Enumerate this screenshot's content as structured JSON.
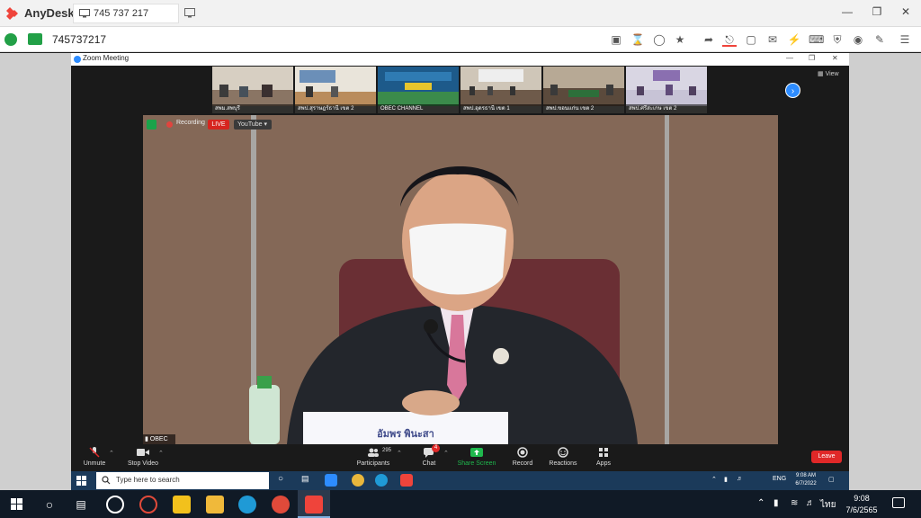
{
  "anydesk": {
    "brand": "AnyDesk",
    "tab_label": "745 737 217",
    "address": "745737217"
  },
  "zoom": {
    "window_title": "Zoom Meeting",
    "view_label": "View",
    "thumbnails": [
      {
        "label": "สพม.สพบุรี"
      },
      {
        "label": "สพป.สุราษฎร์ธานี เขต 2"
      },
      {
        "label": "OBEC CHANNEL"
      },
      {
        "label": "สพป.อุดรธานี เขต 1"
      },
      {
        "label": "สพป.ขอนแก่น เขต 2"
      },
      {
        "label": "สพป.ศรีสะเกษ เขต 2"
      }
    ],
    "recording": {
      "label": "Recording",
      "live": "LIVE",
      "platform": "YouTube"
    },
    "speaker_name": "OBEC",
    "nameplate": "อัมพร พินะสา",
    "controls": {
      "unmute": "Unmute",
      "stop_video": "Stop Video",
      "participants": "Participants",
      "participants_count": "295",
      "chat": "Chat",
      "chat_badge": "4",
      "share_screen": "Share Screen",
      "record": "Record",
      "reactions": "Reactions",
      "apps": "Apps",
      "leave": "Leave"
    }
  },
  "remote_taskbar": {
    "search_placeholder": "Type here to search",
    "language": "ENG",
    "time": "9:08 AM",
    "date": "6/7/2022"
  },
  "host_taskbar": {
    "language": "ไทย",
    "time": "9:08",
    "date": "7/6/2565"
  }
}
